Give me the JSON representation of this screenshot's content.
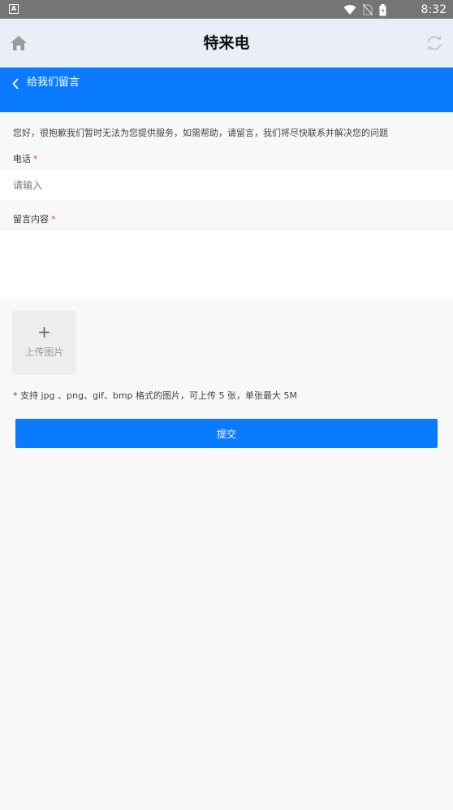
{
  "status_bar": {
    "time": "8:32"
  },
  "header": {
    "title": "特来电"
  },
  "page_bar": {
    "back_label": "给我们留言"
  },
  "form": {
    "notice": "您好，很抱歉我们暂时无法为您提供服务，如需帮助，请留言，我们将尽快联系并解决您的问题",
    "phone_label": "电话",
    "phone_placeholder": "请输入",
    "message_label": "留言内容",
    "required_mark": "*",
    "upload_plus": "+",
    "upload_label": "上传图片",
    "upload_hint": "* 支持 jpg 、png、gif、bmp 格式的图片，可上传 5 张，单张最大 5M",
    "submit_label": "提交"
  },
  "colors": {
    "primary": "#0a7bff",
    "header_bg": "#eaeef7",
    "status_bg": "#757575",
    "required": "#e64340"
  },
  "icons": [
    "home-icon",
    "refresh-icon",
    "back-chevron-icon",
    "wifi-icon",
    "no-sim-icon",
    "battery-icon"
  ]
}
